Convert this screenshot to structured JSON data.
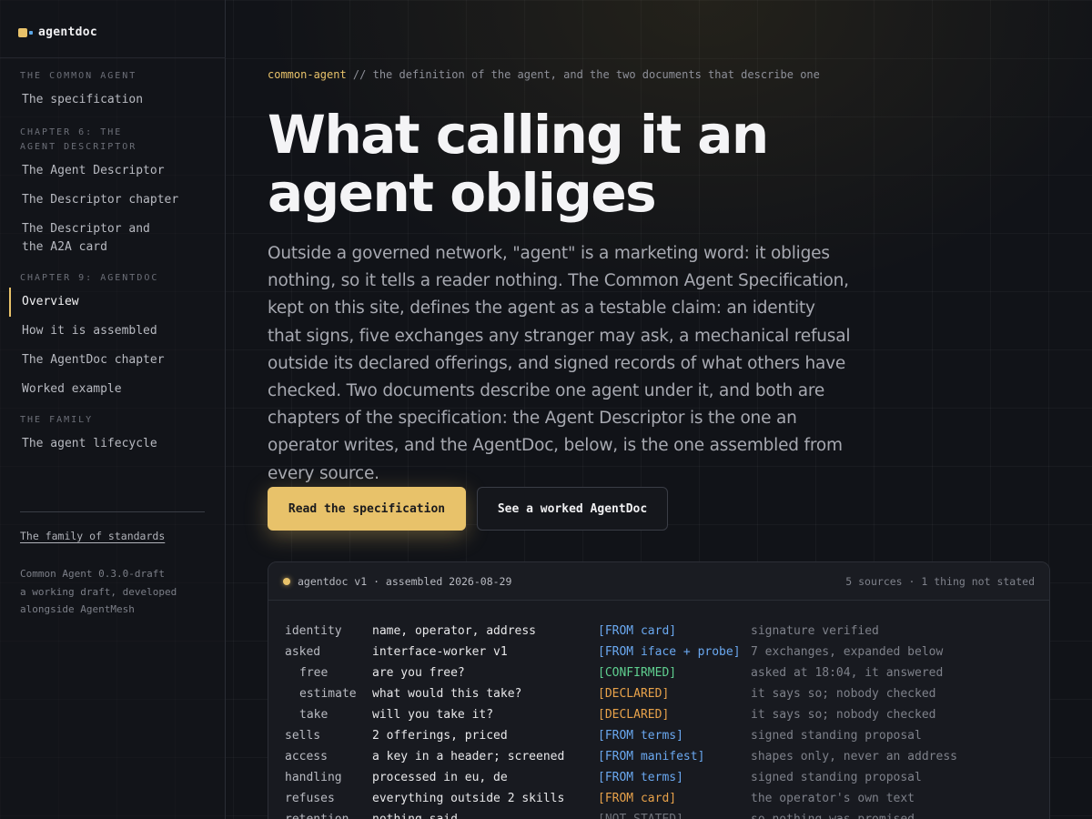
{
  "colors": {
    "accent": "#e8c26a",
    "from": "#6aa8f0",
    "confirmed": "#5fcf8f",
    "declared": "#e8a24a",
    "not_stated": "#6f727a"
  },
  "logo": {
    "name": "agentdoc",
    "icon": "agentdoc-logo-icon"
  },
  "sidebar": {
    "sections": [
      {
        "title": "THE COMMON AGENT",
        "items": [
          {
            "label": "The specification"
          }
        ]
      },
      {
        "title": "CHAPTER 6: THE AGENT DESCRIPTOR",
        "items": [
          {
            "label": "The Agent Descriptor"
          },
          {
            "label": "The Descriptor chapter"
          },
          {
            "label": "The Descriptor and the A2A card"
          }
        ]
      },
      {
        "title": "CHAPTER 9: AGENTDOC",
        "items": [
          {
            "label": "Overview",
            "active": true
          },
          {
            "label": "How it is assembled"
          },
          {
            "label": "The AgentDoc chapter"
          },
          {
            "label": "Worked example"
          }
        ]
      },
      {
        "title": "THE FAMILY",
        "items": [
          {
            "label": "The agent lifecycle"
          }
        ]
      }
    ],
    "family_link": "The family of standards",
    "footer": [
      "Common Agent 0.3.0-draft",
      "a working draft, developed",
      "alongside AgentMesh"
    ]
  },
  "main": {
    "crumb_accent": "common-agent",
    "crumb_rest": " // the definition of the agent, and the two documents that describe one",
    "headline": "What calling it an agent obliges",
    "lede": "Outside a governed network, \"agent\" is a marketing word: it obliges nothing, so it tells a reader nothing. The Common Agent Specification, kept on this site, defines the agent as a testable claim: an identity that signs, five exchanges any stranger may ask, a mechanical refusal outside its declared offerings, and signed records of what others have checked. Two documents describe one agent under it, and both are chapters of the specification: the Agent Descriptor is the one an operator writes, and the AgentDoc, below, is the one assembled from every source.",
    "primary_button": "Read the specification",
    "secondary_button": "See a worked AgentDoc"
  },
  "card": {
    "title": "agentdoc v1 · assembled 2026-08-29",
    "meta": "5 sources · 1 thing not stated",
    "rows": [
      {
        "key": "identity",
        "sub": false,
        "value": "name, operator, address",
        "tag": "[FROM card]",
        "tag_kind": "from",
        "note": "signature verified"
      },
      {
        "key": "asked",
        "sub": false,
        "value": "interface-worker v1",
        "tag": "[FROM iface + probe]",
        "tag_kind": "from",
        "note": "7 exchanges, expanded below"
      },
      {
        "key": "free",
        "sub": true,
        "value": "are you free?",
        "tag": "[CONFIRMED]",
        "tag_kind": "confirmed",
        "note": "asked at 18:04, it answered"
      },
      {
        "key": "estimate",
        "sub": true,
        "value": "what would this take?",
        "tag": "[DECLARED]",
        "tag_kind": "declared",
        "note": "it says so; nobody checked"
      },
      {
        "key": "take",
        "sub": true,
        "value": "will you take it?",
        "tag": "[DECLARED]",
        "tag_kind": "declared",
        "note": "it says so; nobody checked"
      },
      {
        "key": "sells",
        "sub": false,
        "value": "2 offerings, priced",
        "tag": "[FROM terms]",
        "tag_kind": "from",
        "note": "signed standing proposal"
      },
      {
        "key": "access",
        "sub": false,
        "value": "a key in a header; screened",
        "tag": "[FROM manifest]",
        "tag_kind": "from",
        "note": "shapes only, never an address"
      },
      {
        "key": "handling",
        "sub": false,
        "value": "processed in eu, de",
        "tag": "[FROM terms]",
        "tag_kind": "from",
        "note": "signed standing proposal"
      },
      {
        "key": "refuses",
        "sub": false,
        "value": "everything outside 2 skills",
        "tag": "[FROM card]",
        "tag_kind": "declared",
        "note": "the operator's own text"
      },
      {
        "key": "retention",
        "sub": false,
        "value": "nothing said",
        "tag": "[NOT STATED]",
        "tag_kind": "not_stated",
        "note": "so nothing was promised"
      }
    ]
  }
}
